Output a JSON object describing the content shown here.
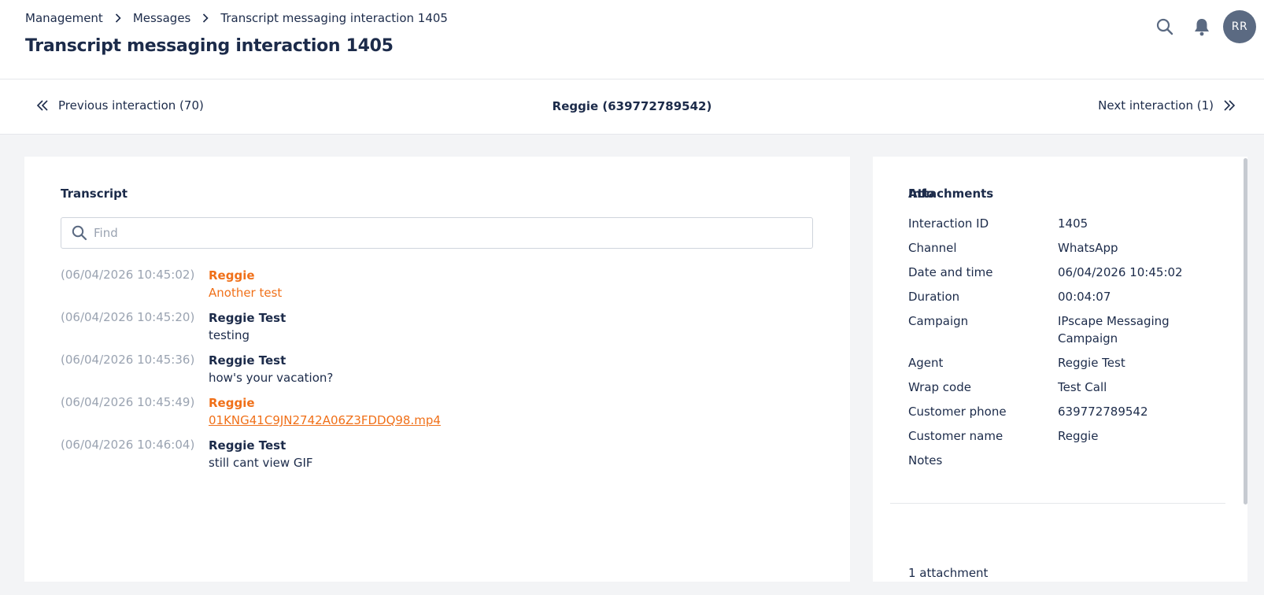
{
  "breadcrumb": {
    "items": [
      "Management",
      "Messages"
    ],
    "current": "Transcript messaging interaction 1405"
  },
  "page_title": "Transcript messaging interaction 1405",
  "header": {
    "icons": [
      "search-icon",
      "bell-icon"
    ],
    "avatar_initials": "RR"
  },
  "nav": {
    "previous": "Previous interaction (70)",
    "center": "Reggie (639772789542)",
    "next": "Next interaction (1)"
  },
  "transcript": {
    "title": "Transcript",
    "find_placeholder": "Find",
    "messages": [
      {
        "time": "(06/04/2026 10:45:02)",
        "sender": "Reggie",
        "text": "Another test",
        "role": "customer"
      },
      {
        "time": "(06/04/2026 10:45:20)",
        "sender": "Reggie Test",
        "text": "testing",
        "role": "agent"
      },
      {
        "time": "(06/04/2026 10:45:36)",
        "sender": "Reggie Test",
        "text": "how's your vacation?",
        "role": "agent"
      },
      {
        "time": "(06/04/2026 10:45:49)",
        "sender": "Reggie",
        "text": "01KNG41C9JN2742A06Z3FDDQ98.mp4",
        "role": "customer",
        "is_link": true
      },
      {
        "time": "(06/04/2026 10:46:04)",
        "sender": "Reggie Test",
        "text": "still cant view GIF",
        "role": "agent"
      }
    ]
  },
  "info": {
    "title": "Info",
    "rows": [
      {
        "label": "Interaction ID",
        "value": "1405"
      },
      {
        "label": "Channel",
        "value": "WhatsApp"
      },
      {
        "label": "Date and time",
        "value": "06/04/2026 10:45:02"
      },
      {
        "label": "Duration",
        "value": "00:04:07"
      },
      {
        "label": "Campaign",
        "value": "IPscape Messaging Campaign"
      },
      {
        "label": "Agent",
        "value": "Reggie Test"
      },
      {
        "label": "Wrap code",
        "value": "Test Call"
      },
      {
        "label": "Customer phone",
        "value": "639772789542"
      },
      {
        "label": "Customer name",
        "value": "Reggie"
      },
      {
        "label": "Notes",
        "value": ""
      }
    ]
  },
  "attachments": {
    "title": "Attachments",
    "count_label": "1 attachment"
  },
  "colors": {
    "text": "#1c2b4a",
    "customer": "#f07019",
    "muted": "#9aa3b1",
    "avatar_bg": "#5b6a82"
  }
}
